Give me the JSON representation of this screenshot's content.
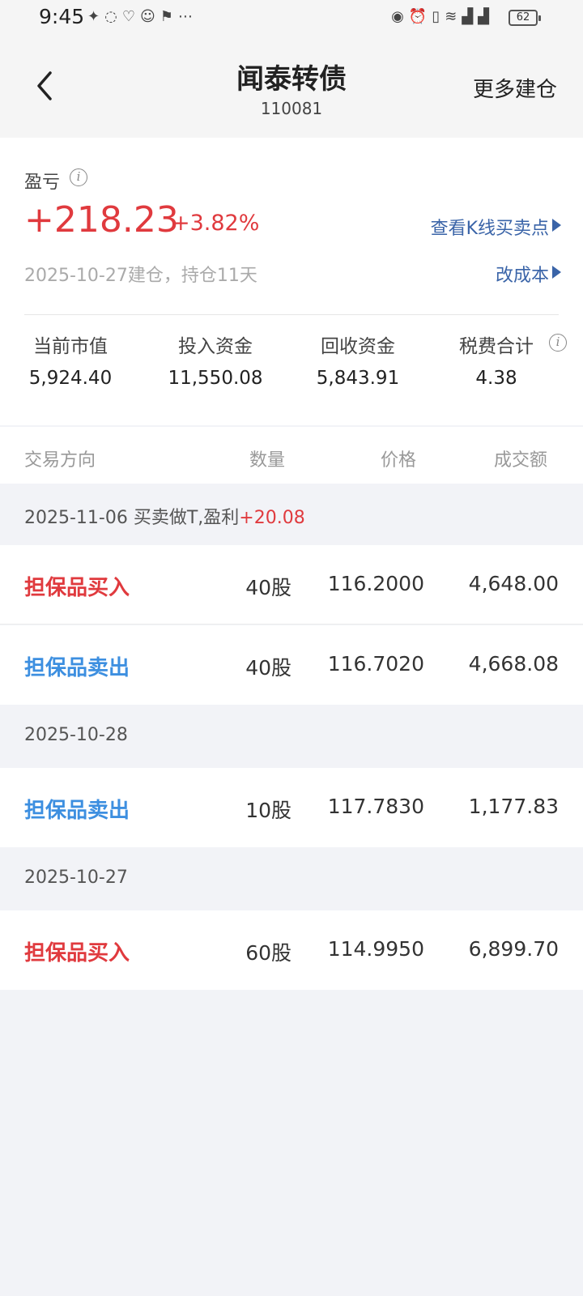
{
  "status_bar": {
    "time": "9:45",
    "battery": "62",
    "icons_left": [
      "notification-icon",
      "notification-icon",
      "notification-icon",
      "notification-icon",
      "notification-icon"
    ],
    "icons_right": [
      "eye-icon",
      "alarm-icon",
      "vibrate-icon",
      "wifi-icon",
      "signal-icon",
      "signal-icon"
    ]
  },
  "header": {
    "title": "闻泰转债",
    "code": "110081",
    "more_label": "更多建仓"
  },
  "summary": {
    "pl_label": "盈亏",
    "pl_value": "+218.23",
    "pl_pct": "+3.82%",
    "since": "2025-10-27建仓，持仓11天",
    "link_kline": "查看K线买卖点",
    "link_cost": "改成本",
    "stats": [
      {
        "label": "当前市值",
        "value": "5,924.40"
      },
      {
        "label": "投入资金",
        "value": "11,550.08"
      },
      {
        "label": "回收资金",
        "value": "5,843.91"
      },
      {
        "label": "税费合计",
        "value": "4.38"
      }
    ]
  },
  "table": {
    "headers": {
      "direction": "交易方向",
      "qty": "数量",
      "price": "价格",
      "amount": "成交额"
    },
    "groups": [
      {
        "date": "2025-11-06 买卖做T,盈利",
        "profit": "+20.08",
        "rows": [
          {
            "direction": "担保品买入",
            "qty": "40股",
            "price": "116.2000",
            "amount": "4,648.00"
          },
          {
            "direction": "担保品卖出",
            "qty": "40股",
            "price": "116.7020",
            "amount": "4,668.08"
          }
        ]
      },
      {
        "date": "2025-10-28",
        "rows": [
          {
            "direction": "担保品卖出",
            "qty": "10股",
            "price": "117.7830",
            "amount": "1,177.83"
          }
        ]
      },
      {
        "date": "2025-10-27",
        "rows": [
          {
            "direction": "担保品买入",
            "qty": "60股",
            "price": "114.9950",
            "amount": "6,899.70"
          }
        ]
      }
    ]
  },
  "colors": {
    "profit_red": "#e03a3e",
    "sell_blue": "#3d8fe0",
    "link_blue": "#3a64a8"
  }
}
